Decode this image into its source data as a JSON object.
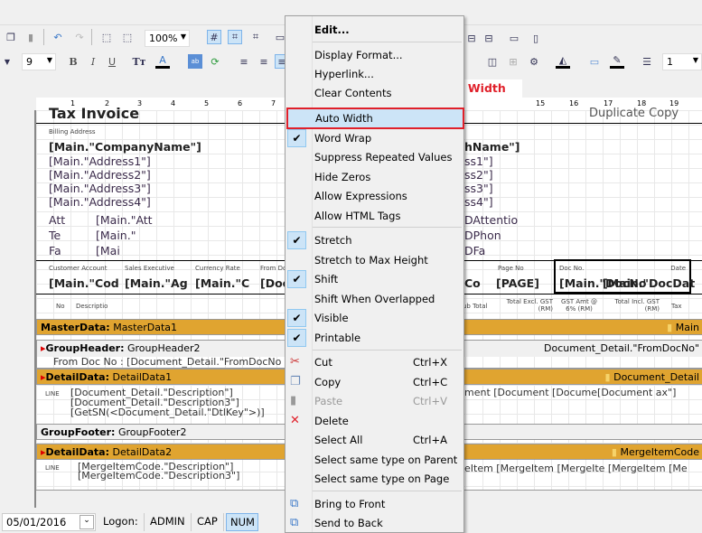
{
  "toolbar": {
    "zoom": "100%",
    "font_size": "9",
    "line_width": "1",
    "bold": "B",
    "italic": "I",
    "underline": "U"
  },
  "ruler": {
    "ticks_left": [
      "1",
      "2",
      "3",
      "4",
      "5",
      "6",
      "7"
    ],
    "ticks_right": [
      "15",
      "16",
      "17",
      "18",
      "19"
    ]
  },
  "report": {
    "title": "Tax Invoice",
    "copy_label": "Duplicate Copy",
    "billing_label": "Billing Address",
    "company": "[Main.\"CompanyName\"]",
    "company_right": "hName\"]",
    "addresses": [
      "[Main.\"Address1\"]",
      "[Main.\"Address2\"]",
      "[Main.\"Address3\"]",
      "[Main.\"Address4\"]"
    ],
    "addresses_right": [
      "ss1\"]",
      "ss2\"]",
      "ss3\"]",
      "ss4\"]"
    ],
    "contact_labels": [
      "Att",
      "Te",
      "Fa"
    ],
    "contact_values": [
      "[Main.\"Att",
      "[Main.\"",
      "[Mai"
    ],
    "contact_right": [
      "DAttentio",
      "DPhon",
      "DFa"
    ],
    "header_labels": [
      "Customer Account",
      "Sales Executive",
      "Currency Rate",
      "From Do",
      "Page No",
      "Doc No.",
      "Date"
    ],
    "header_values": [
      "[Main.\"Cod",
      "[Main.\"Ag",
      "[Main.\"C",
      "[Doc",
      "Co",
      "[PAGE]",
      "[Main.\"DocNo",
      "[Main.\"DocDat"
    ],
    "col_labels": [
      "No",
      "Descriptio",
      "ub Total",
      "Total Excl. GST (RM)",
      "GST Amt @ 6% (RM)",
      "Total Incl. GST (RM)",
      "Tax"
    ],
    "bands": [
      {
        "type": "MasterData:",
        "name": "MasterData1",
        "source": "Main"
      },
      {
        "type": "GroupHeader:",
        "name": "GroupHeader2",
        "source": "Document_Detail.\"FromDocNo\""
      },
      {
        "type": "DetailData:",
        "name": "DetailData1",
        "source": "Document_Detail"
      },
      {
        "type": "GroupFooter:",
        "name": "GroupFooter2",
        "source": ""
      },
      {
        "type": "DetailData:",
        "name": "DetailData2",
        "source": "MergeItemCode"
      }
    ],
    "group_header_text": "From Doc No : [Document_Detail.\"FromDocNo",
    "detail1_lines": [
      "[Document_Detail.\"Description\"]",
      "[Document_Detail.\"Description3\"]",
      "[GetSN(<Document_Detail.\"DtlKey\">)]"
    ],
    "detail1_right": "ment  [Document   [Docume[Document   ax\"]",
    "detail2_lines": [
      "[MergeItemCode.\"Description\"]",
      "[MergeItemCode.\"Description3\"]"
    ],
    "detail2_right": "eItem [MergeItem [MergeIte [MergeItem [Me",
    "line_label": "LINE"
  },
  "annotation": "Untick Auto Width",
  "accent": "#e0202a",
  "band_color": "#e0a430",
  "menu": {
    "items": [
      {
        "label": "Edit...",
        "bold": true
      },
      {
        "label": "Display Format..."
      },
      {
        "label": "Hyperlink..."
      },
      {
        "label": "Clear Contents"
      },
      {
        "label": "Auto Width",
        "checked": false,
        "highlighted": true
      },
      {
        "label": "Word Wrap",
        "checked": true
      },
      {
        "label": "Suppress Repeated Values"
      },
      {
        "label": "Hide Zeros"
      },
      {
        "label": "Allow Expressions"
      },
      {
        "label": "Allow HTML Tags"
      },
      {
        "label": "Stretch",
        "checked": true
      },
      {
        "label": "Stretch to Max Height"
      },
      {
        "label": "Shift",
        "checked": true
      },
      {
        "label": "Shift When Overlapped"
      },
      {
        "label": "Visible",
        "checked": true
      },
      {
        "label": "Printable",
        "checked": true
      },
      {
        "label": "Cut",
        "shortcut": "Ctrl+X",
        "icon": "scissors-icon"
      },
      {
        "label": "Copy",
        "shortcut": "Ctrl+C",
        "icon": "copy-icon"
      },
      {
        "label": "Paste",
        "shortcut": "Ctrl+V",
        "icon": "paste-icon",
        "disabled": true
      },
      {
        "label": "Delete",
        "icon": "delete-icon"
      },
      {
        "label": "Select All",
        "shortcut": "Ctrl+A"
      },
      {
        "label": "Select same type on Parent"
      },
      {
        "label": "Select same type on Page"
      },
      {
        "label": "Bring to Front",
        "icon": "bring-front-icon"
      },
      {
        "label": "Send to Back",
        "icon": "send-back-icon"
      }
    ]
  },
  "status": {
    "date": "05/01/2016",
    "logon_label": "Logon:",
    "user": "ADMIN",
    "cap": "CAP",
    "num": "NUM"
  }
}
